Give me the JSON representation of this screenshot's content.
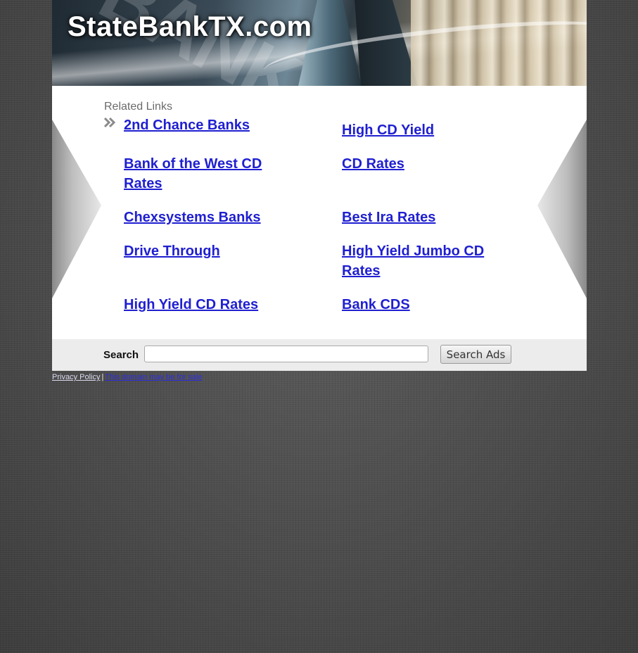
{
  "site": {
    "title": "StateBankTX.com"
  },
  "related": {
    "heading": "Related Links",
    "left_links": [
      "2nd Chance Banks",
      "Bank of the West CD Rates",
      "Chexsystems Banks",
      "Drive Through",
      "High Yield CD Rates"
    ],
    "right_links": [
      "High CD Yield",
      "CD Rates",
      "Best Ira Rates",
      "High Yield Jumbo CD Rates",
      "Bank CDS"
    ]
  },
  "search": {
    "label": "Search",
    "input_value": "",
    "button_label": "Search Ads"
  },
  "footer": {
    "privacy_label": "Privacy Policy",
    "separator": "|",
    "sale_label": "This domain may be for sale"
  },
  "colors": {
    "link": "#1f1fd1",
    "heading": "#6b6b6b",
    "content_bg": "#ffffff",
    "search_bg": "#ececec"
  },
  "icons": {
    "bullet": "double-chevron-right-icon"
  }
}
